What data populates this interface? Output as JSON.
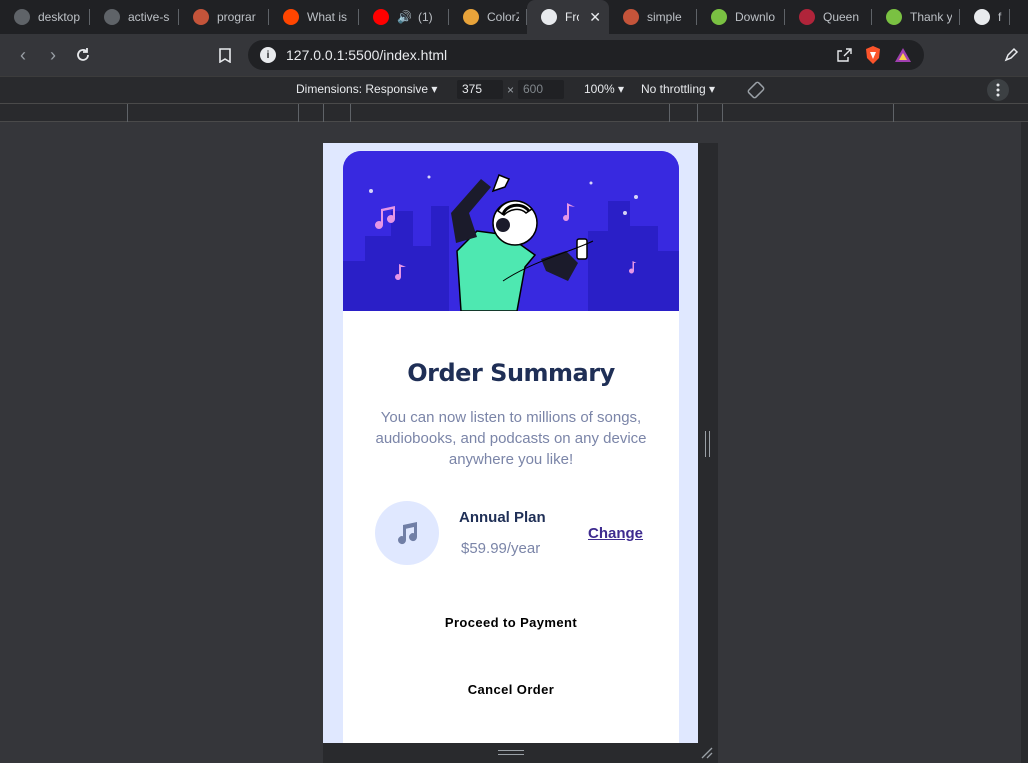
{
  "tabs": [
    {
      "title": "desktop",
      "favicon": "globe-icon",
      "color": "#5f6368"
    },
    {
      "title": "active-s",
      "favicon": "globe-icon",
      "color": "#5f6368"
    },
    {
      "title": "prograr",
      "favicon": "brave-search-icon",
      "color": "#c4543a"
    },
    {
      "title": "What is",
      "favicon": "reddit-icon",
      "color": "#ff4500"
    },
    {
      "title": "(1)",
      "favicon": "youtube-icon",
      "color": "#ff0000",
      "audio": "🔊"
    },
    {
      "title": "ColorZi",
      "favicon": "colorzilla-icon",
      "color": "#e8a33a"
    },
    {
      "title": "Fro",
      "favicon": "frontend-mentor-icon",
      "color": "#e8eaed",
      "active": true
    },
    {
      "title": "simple",
      "favicon": "brave-search-icon",
      "color": "#c4543a"
    },
    {
      "title": "Downlo",
      "favicon": "download-icon",
      "color": "#7ac142"
    },
    {
      "title": "Queen",
      "favicon": "queen-icon",
      "color": "#b0243a"
    },
    {
      "title": "Thank y",
      "favicon": "download-icon",
      "color": "#7ac142"
    },
    {
      "title": "fire",
      "favicon": "fire-icon",
      "color": "#e8eaed"
    }
  ],
  "tab_close": "✕",
  "address": {
    "url": "127.0.0.1:5500/index.html"
  },
  "devtools": {
    "dimensions_label": "Dimensions: Responsive",
    "width": "375",
    "times": "×",
    "height_placeholder": "600",
    "zoom": "100%",
    "throttling": "No throttling"
  },
  "order": {
    "title": "Order Summary",
    "description": "You can now listen to millions of songs, audiobooks, and podcasts on any device anywhere you like!",
    "plan_name": "Annual Plan",
    "plan_price": "$59.99/year",
    "change_link": "Change",
    "proceed_button": "Proceed to Payment",
    "cancel_button": "Cancel Order"
  },
  "colors": {
    "hero": "#3829e0",
    "title": "#1f2f56",
    "desc": "#7b85a8",
    "page_bg": "#e0e8ff"
  }
}
